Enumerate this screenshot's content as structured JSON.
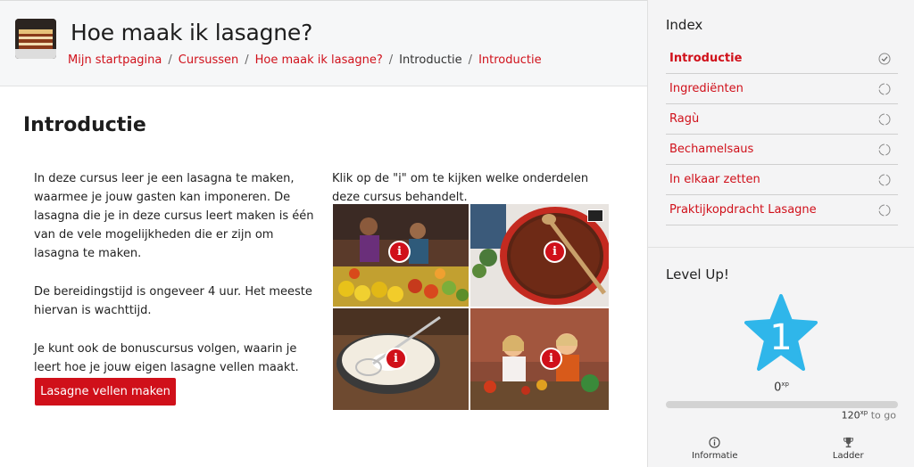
{
  "header": {
    "course_title": "Hoe maak ik lasagne?",
    "breadcrumb": [
      "Mijn startpagina",
      "Cursussen",
      "Hoe maak ik lasagne?",
      "Introductie",
      "Introductie"
    ],
    "separator": "/"
  },
  "main": {
    "title": "Introductie",
    "paragraphs": [
      "In deze cursus leer je een lasagna te maken, waarmee je jouw gasten kan imponeren. De lasagna die je in deze cursus leert maken is één van de vele mogelijkheden die er zijn om lasagna te maken.",
      "De bereidingstijd is ongeveer 4 uur. Het meeste hiervan is wachttijd.",
      "Je kunt ook de bonuscursus volgen, waarin je leert hoe je jouw eigen lasagne vellen maakt."
    ],
    "cta_label": "Lasagne vellen maken",
    "click_hint": "Klik op de \"i\" om te kijken welke onderdelen deze cursus behandelt.",
    "info_glyph": "i"
  },
  "sidebar": {
    "index_title": "Index",
    "items": [
      {
        "label": "Introductie",
        "status": "completed"
      },
      {
        "label": "Ingrediënten",
        "status": "pending"
      },
      {
        "label": "Ragù",
        "status": "pending"
      },
      {
        "label": "Bechamelsaus",
        "status": "pending"
      },
      {
        "label": "In elkaar zetten",
        "status": "pending"
      },
      {
        "label": "Praktijkopdracht Lasagne",
        "status": "pending"
      }
    ],
    "levelup_title": "Level Up!",
    "level": "1",
    "xp_current": "0",
    "xp_sup": "xp",
    "xp_goal": "120",
    "xp_goal_suffix": "to go",
    "progress_fraction": 0,
    "tabs": [
      {
        "label": "Informatie",
        "icon": "info-icon"
      },
      {
        "label": "Ladder",
        "icon": "trophy-icon"
      }
    ]
  },
  "colors": {
    "accent": "#d0101a",
    "level_star": "#2fb6ea"
  }
}
